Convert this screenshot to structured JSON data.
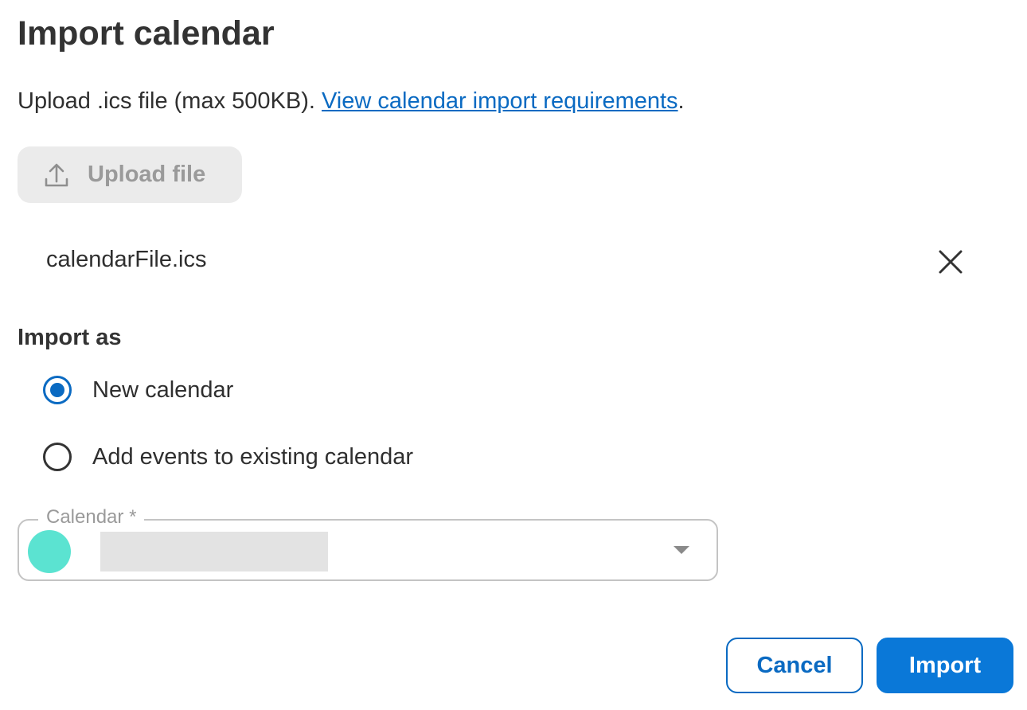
{
  "dialog": {
    "title": "Import calendar",
    "description": "Upload .ics file (max 500KB). ",
    "requirements_link": "View calendar import requirements",
    "description_end": "."
  },
  "upload": {
    "label": "Upload file",
    "icon": "upload-icon",
    "disabled": true
  },
  "file": {
    "name": "calendarFile.ics",
    "remove_icon": "close-icon"
  },
  "import_as": {
    "label": "Import as",
    "options": [
      {
        "label": "New calendar",
        "selected": true
      },
      {
        "label": "Add events to existing calendar",
        "selected": false
      }
    ]
  },
  "calendar_select": {
    "label": "Calendar",
    "required_marker": "*",
    "swatch_color": "#5be3d1",
    "icon": "chevron-down-icon"
  },
  "actions": {
    "cancel_label": "Cancel",
    "import_label": "Import"
  },
  "colors": {
    "accent": "#0a6ac2",
    "primary_button": "#0a78d8"
  }
}
